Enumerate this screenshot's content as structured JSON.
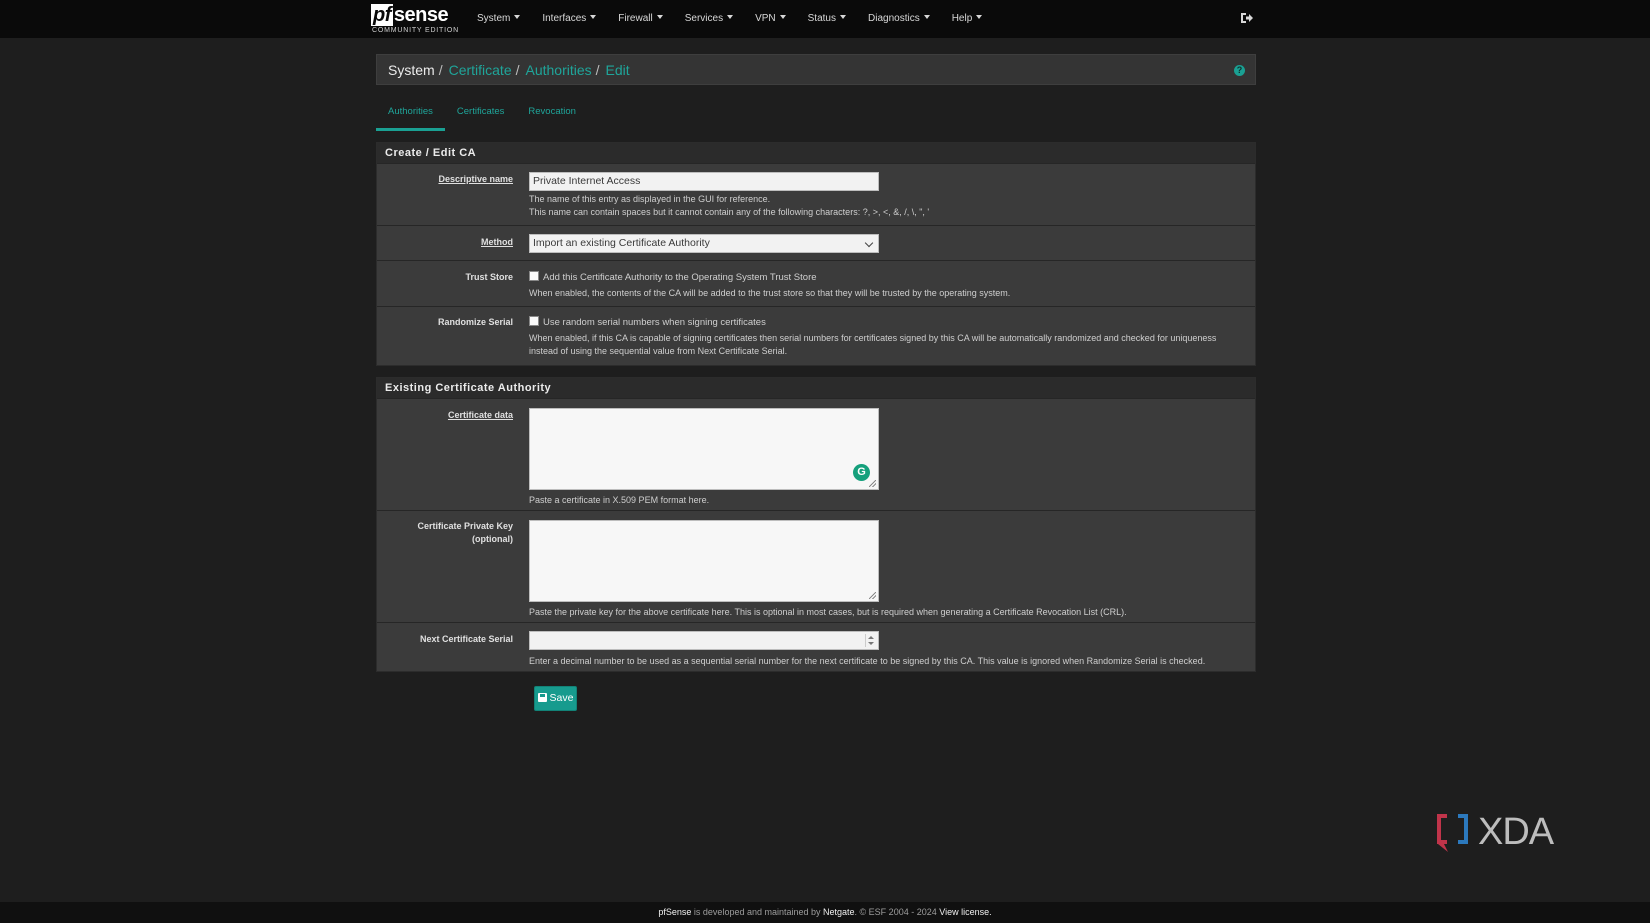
{
  "navbar": {
    "brand": {
      "main_pf": "pf",
      "main_rest": "sense",
      "sub": "COMMUNITY EDITION"
    },
    "menu": [
      {
        "label": "System"
      },
      {
        "label": "Interfaces"
      },
      {
        "label": "Firewall"
      },
      {
        "label": "Services"
      },
      {
        "label": "VPN"
      },
      {
        "label": "Status"
      },
      {
        "label": "Diagnostics"
      },
      {
        "label": "Help"
      }
    ],
    "logout_icon": "sign-out-icon"
  },
  "breadcrumb": {
    "items": [
      "System",
      "Certificate",
      "Authorities",
      "Edit"
    ],
    "separator": "/",
    "help_icon": "question-circle-icon"
  },
  "tabs": [
    {
      "label": "Authorities",
      "active": true
    },
    {
      "label": "Certificates",
      "active": false
    },
    {
      "label": "Revocation",
      "active": false
    }
  ],
  "create_panel": {
    "heading": "Create / Edit CA",
    "descriptive_name": {
      "label": "Descriptive name",
      "value": "Private Internet Access",
      "help1": "The name of this entry as displayed in the GUI for reference.",
      "help2": "This name can contain spaces but it cannot contain any of the following characters: ?, >, <, &, /, \\, \", '"
    },
    "method": {
      "label": "Method",
      "selected": "Import an existing Certificate Authority"
    },
    "trust_store": {
      "label": "Trust Store",
      "checkbox_label": "Add this Certificate Authority to the Operating System Trust Store",
      "checked": false,
      "help": "When enabled, the contents of the CA will be added to the trust store so that they will be trusted by the operating system."
    },
    "randomize_serial": {
      "label": "Randomize Serial",
      "checkbox_label": "Use random serial numbers when signing certificates",
      "checked": false,
      "help1": "When enabled, if this CA is capable of signing certificates then serial numbers for certificates signed by this CA will be automatically randomized and checked for uniqueness",
      "help2": "instead of using the sequential value from Next Certificate Serial."
    }
  },
  "existing_panel": {
    "heading": "Existing Certificate Authority",
    "certificate_data": {
      "label": "Certificate data",
      "value": "",
      "help": "Paste a certificate in X.509 PEM format here."
    },
    "private_key": {
      "label1": "Certificate Private Key",
      "label2": "(optional)",
      "value": "",
      "help": "Paste the private key for the above certificate here. This is optional in most cases, but is required when generating a Certificate Revocation List (CRL)."
    },
    "next_serial": {
      "label": "Next Certificate Serial",
      "value": "",
      "help": "Enter a decimal number to be used as a sequential serial number for the next certificate to be signed by this CA. This value is ignored when Randomize Serial is checked."
    }
  },
  "save_button": {
    "label": "Save",
    "icon": "save-icon"
  },
  "watermark": {
    "text": "XDA"
  },
  "footer": {
    "brand": "pfSense",
    "text1": " is developed and maintained by ",
    "company": "Netgate",
    "text2": ". © ESF 2004 - 2024 ",
    "license": "View license."
  },
  "colors": {
    "accent": "#1aa093",
    "navbar_bg": "#0a0a0a",
    "page_bg": "#1e1e1e",
    "panel_bg": "#3b3b3b",
    "panel_heading_bg": "#2b2b2b"
  }
}
